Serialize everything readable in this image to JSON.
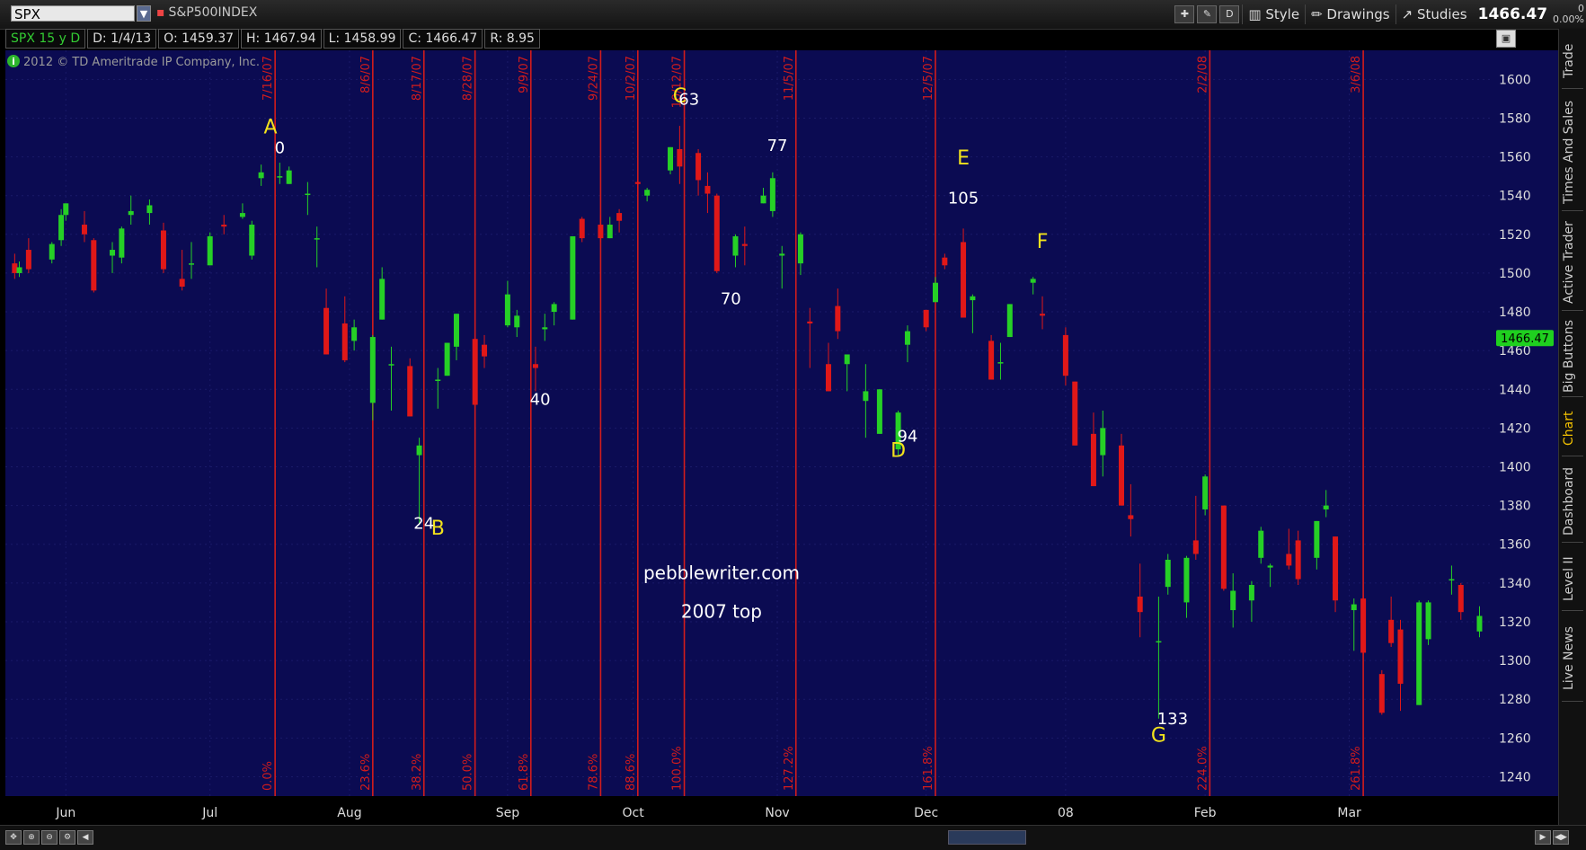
{
  "toolbar": {
    "symbol": "SPX",
    "symbol_name": "S&P500INDEX",
    "style_label": "Style",
    "drawings_label": "Drawings",
    "studies_label": "Studies",
    "d_label": "D",
    "price": "1466.47",
    "change": "0",
    "change_pct": "0.00%"
  },
  "infobar": {
    "symbol_period": "SPX 15 y D",
    "date": "D: 1/4/13",
    "open": "O: 1459.37",
    "high": "H: 1467.94",
    "low": "L: 1458.99",
    "close": "C: 1466.47",
    "range": "R: 8.95"
  },
  "sidebar": {
    "tabs": [
      "Trade",
      "Times And Sales",
      "Active Trader",
      "Big Buttons",
      "Chart",
      "Dashboard",
      "Level II",
      "Live News"
    ],
    "active": "Chart"
  },
  "colors": {
    "background": "#0b0b52",
    "grid": "#1a1a68",
    "up": "#26d026",
    "down": "#e01818",
    "vline": "#d21c1c",
    "letter": "#f2e21c",
    "number": "#ffffff",
    "price_tag": "#1fd01f"
  },
  "chart_data": {
    "type": "candlestick",
    "title": "",
    "copyright": "2012 © TD Ameritrade IP Company, Inc.",
    "ylim": [
      1230,
      1615
    ],
    "y_ticks": [
      1240,
      1260,
      1280,
      1300,
      1320,
      1340,
      1360,
      1380,
      1400,
      1420,
      1440,
      1460,
      1480,
      1500,
      1520,
      1540,
      1560,
      1580,
      1600
    ],
    "x_labels": [
      {
        "label": "Jun",
        "date": "2007-06-01"
      },
      {
        "label": "Jul",
        "date": "2007-07-02"
      },
      {
        "label": "Aug",
        "date": "2007-08-01"
      },
      {
        "label": "Sep",
        "date": "2007-09-04"
      },
      {
        "label": "Oct",
        "date": "2007-10-01"
      },
      {
        "label": "Nov",
        "date": "2007-11-01"
      },
      {
        "label": "Dec",
        "date": "2007-12-03"
      },
      {
        "label": "08",
        "date": "2008-01-02"
      },
      {
        "label": "Feb",
        "date": "2008-02-01"
      },
      {
        "label": "Mar",
        "date": "2008-03-03"
      }
    ],
    "current_price_tag": 1466.47,
    "date_range": [
      "2007-05-21",
      "2008-03-31"
    ],
    "candles": [
      {
        "d": "2007-05-21",
        "o": 1505,
        "h": 1510,
        "l": 1497,
        "c": 1500
      },
      {
        "d": "2007-05-22",
        "o": 1500,
        "h": 1506,
        "l": 1498,
        "c": 1503
      },
      {
        "d": "2007-05-24",
        "o": 1512,
        "h": 1518,
        "l": 1500,
        "c": 1502
      },
      {
        "d": "2007-05-29",
        "o": 1507,
        "h": 1516,
        "l": 1505,
        "c": 1515
      },
      {
        "d": "2007-05-31",
        "o": 1517,
        "h": 1533,
        "l": 1514,
        "c": 1530
      },
      {
        "d": "2007-06-01",
        "o": 1530,
        "h": 1536,
        "l": 1527,
        "c": 1536
      },
      {
        "d": "2007-06-05",
        "o": 1525,
        "h": 1532,
        "l": 1516,
        "c": 1520
      },
      {
        "d": "2007-06-07",
        "o": 1517,
        "h": 1518,
        "l": 1490,
        "c": 1491
      },
      {
        "d": "2007-06-11",
        "o": 1509,
        "h": 1516,
        "l": 1500,
        "c": 1512
      },
      {
        "d": "2007-06-13",
        "o": 1508,
        "h": 1524,
        "l": 1505,
        "c": 1523
      },
      {
        "d": "2007-06-15",
        "o": 1530,
        "h": 1540,
        "l": 1525,
        "c": 1532
      },
      {
        "d": "2007-06-19",
        "o": 1531,
        "h": 1538,
        "l": 1525,
        "c": 1535
      },
      {
        "d": "2007-06-22",
        "o": 1522,
        "h": 1526,
        "l": 1500,
        "c": 1502
      },
      {
        "d": "2007-06-26",
        "o": 1497,
        "h": 1512,
        "l": 1491,
        "c": 1493
      },
      {
        "d": "2007-06-28",
        "o": 1505,
        "h": 1516,
        "l": 1497,
        "c": 1505
      },
      {
        "d": "2007-07-02",
        "o": 1504,
        "h": 1521,
        "l": 1504,
        "c": 1519
      },
      {
        "d": "2007-07-05",
        "o": 1525,
        "h": 1530,
        "l": 1520,
        "c": 1524
      },
      {
        "d": "2007-07-09",
        "o": 1529,
        "h": 1536,
        "l": 1528,
        "c": 1531
      },
      {
        "d": "2007-07-11",
        "o": 1509,
        "h": 1527,
        "l": 1507,
        "c": 1525
      },
      {
        "d": "2007-07-13",
        "o": 1549,
        "h": 1556,
        "l": 1545,
        "c": 1552
      },
      {
        "d": "2007-07-17",
        "o": 1550,
        "h": 1557,
        "l": 1546,
        "c": 1550
      },
      {
        "d": "2007-07-19",
        "o": 1546,
        "h": 1555,
        "l": 1546,
        "c": 1553
      },
      {
        "d": "2007-07-23",
        "o": 1541,
        "h": 1547,
        "l": 1530,
        "c": 1541
      },
      {
        "d": "2007-07-25",
        "o": 1518,
        "h": 1524,
        "l": 1503,
        "c": 1518
      },
      {
        "d": "2007-07-27",
        "o": 1482,
        "h": 1492,
        "l": 1458,
        "c": 1458
      },
      {
        "d": "2007-07-31",
        "o": 1474,
        "h": 1488,
        "l": 1454,
        "c": 1455
      },
      {
        "d": "2007-08-02",
        "o": 1465,
        "h": 1476,
        "l": 1460,
        "c": 1472
      },
      {
        "d": "2007-08-06",
        "o": 1433,
        "h": 1468,
        "l": 1424,
        "c": 1467
      },
      {
        "d": "2007-08-08",
        "o": 1476,
        "h": 1503,
        "l": 1476,
        "c": 1497
      },
      {
        "d": "2007-08-10",
        "o": 1453,
        "h": 1462,
        "l": 1429,
        "c": 1453
      },
      {
        "d": "2007-08-14",
        "o": 1452,
        "h": 1456,
        "l": 1426,
        "c": 1426
      },
      {
        "d": "2007-08-16",
        "o": 1406,
        "h": 1415,
        "l": 1370,
        "c": 1411
      },
      {
        "d": "2007-08-20",
        "o": 1445,
        "h": 1451,
        "l": 1430,
        "c": 1445
      },
      {
        "d": "2007-08-22",
        "o": 1447,
        "h": 1464,
        "l": 1447,
        "c": 1464
      },
      {
        "d": "2007-08-24",
        "o": 1462,
        "h": 1479,
        "l": 1455,
        "c": 1479
      },
      {
        "d": "2007-08-28",
        "o": 1466,
        "h": 1466,
        "l": 1432,
        "c": 1432
      },
      {
        "d": "2007-08-30",
        "o": 1463,
        "h": 1468,
        "l": 1451,
        "c": 1457
      },
      {
        "d": "2007-09-04",
        "o": 1473,
        "h": 1496,
        "l": 1472,
        "c": 1489
      },
      {
        "d": "2007-09-06",
        "o": 1472,
        "h": 1481,
        "l": 1467,
        "c": 1478
      },
      {
        "d": "2007-09-10",
        "o": 1453,
        "h": 1462,
        "l": 1439,
        "c": 1451
      },
      {
        "d": "2007-09-12",
        "o": 1471,
        "h": 1479,
        "l": 1465,
        "c": 1472
      },
      {
        "d": "2007-09-14",
        "o": 1480,
        "h": 1485,
        "l": 1473,
        "c": 1484
      },
      {
        "d": "2007-09-18",
        "o": 1476,
        "h": 1519,
        "l": 1476,
        "c": 1519
      },
      {
        "d": "2007-09-20",
        "o": 1528,
        "h": 1529,
        "l": 1516,
        "c": 1518
      },
      {
        "d": "2007-09-24",
        "o": 1525,
        "h": 1530,
        "l": 1516,
        "c": 1518
      },
      {
        "d": "2007-09-26",
        "o": 1518,
        "h": 1529,
        "l": 1518,
        "c": 1525
      },
      {
        "d": "2007-09-28",
        "o": 1531,
        "h": 1533,
        "l": 1521,
        "c": 1527
      },
      {
        "d": "2007-10-02",
        "o": 1547,
        "h": 1548,
        "l": 1540,
        "c": 1546
      },
      {
        "d": "2007-10-04",
        "o": 1540,
        "h": 1544,
        "l": 1537,
        "c": 1543
      },
      {
        "d": "2007-10-09",
        "o": 1553,
        "h": 1565,
        "l": 1551,
        "c": 1565
      },
      {
        "d": "2007-10-11",
        "o": 1564,
        "h": 1576,
        "l": 1546,
        "c": 1555
      },
      {
        "d": "2007-10-15",
        "o": 1562,
        "h": 1564,
        "l": 1540,
        "c": 1548
      },
      {
        "d": "2007-10-17",
        "o": 1545,
        "h": 1552,
        "l": 1531,
        "c": 1541
      },
      {
        "d": "2007-10-19",
        "o": 1540,
        "h": 1541,
        "l": 1500,
        "c": 1501
      },
      {
        "d": "2007-10-23",
        "o": 1509,
        "h": 1520,
        "l": 1503,
        "c": 1519
      },
      {
        "d": "2007-10-25",
        "o": 1515,
        "h": 1524,
        "l": 1504,
        "c": 1514
      },
      {
        "d": "2007-10-29",
        "o": 1536,
        "h": 1544,
        "l": 1536,
        "c": 1540
      },
      {
        "d": "2007-10-31",
        "o": 1532,
        "h": 1552,
        "l": 1529,
        "c": 1549
      },
      {
        "d": "2007-11-02",
        "o": 1509,
        "h": 1514,
        "l": 1492,
        "c": 1510
      },
      {
        "d": "2007-11-06",
        "o": 1505,
        "h": 1521,
        "l": 1499,
        "c": 1520
      },
      {
        "d": "2007-11-08",
        "o": 1475,
        "h": 1482,
        "l": 1451,
        "c": 1474
      },
      {
        "d": "2007-11-12",
        "o": 1453,
        "h": 1464,
        "l": 1439,
        "c": 1439
      },
      {
        "d": "2007-11-14",
        "o": 1483,
        "h": 1492,
        "l": 1466,
        "c": 1470
      },
      {
        "d": "2007-11-16",
        "o": 1453,
        "h": 1456,
        "l": 1439,
        "c": 1458
      },
      {
        "d": "2007-11-20",
        "o": 1434,
        "h": 1453,
        "l": 1415,
        "c": 1439
      },
      {
        "d": "2007-11-23",
        "o": 1417,
        "h": 1440,
        "l": 1417,
        "c": 1440
      },
      {
        "d": "2007-11-27",
        "o": 1409,
        "h": 1429,
        "l": 1406,
        "c": 1428
      },
      {
        "d": "2007-11-29",
        "o": 1463,
        "h": 1473,
        "l": 1454,
        "c": 1470
      },
      {
        "d": "2007-12-03",
        "o": 1481,
        "h": 1481,
        "l": 1470,
        "c": 1472
      },
      {
        "d": "2007-12-05",
        "o": 1485,
        "h": 1498,
        "l": 1485,
        "c": 1495
      },
      {
        "d": "2007-12-07",
        "o": 1508,
        "h": 1510,
        "l": 1502,
        "c": 1504
      },
      {
        "d": "2007-12-11",
        "o": 1516,
        "h": 1523,
        "l": 1477,
        "c": 1477
      },
      {
        "d": "2007-12-13",
        "o": 1486,
        "h": 1489,
        "l": 1469,
        "c": 1488
      },
      {
        "d": "2007-12-17",
        "o": 1465,
        "h": 1468,
        "l": 1445,
        "c": 1445
      },
      {
        "d": "2007-12-19",
        "o": 1454,
        "h": 1464,
        "l": 1445,
        "c": 1454
      },
      {
        "d": "2007-12-21",
        "o": 1467,
        "h": 1484,
        "l": 1467,
        "c": 1484
      },
      {
        "d": "2007-12-26",
        "o": 1495,
        "h": 1498,
        "l": 1489,
        "c": 1497
      },
      {
        "d": "2007-12-28",
        "o": 1479,
        "h": 1488,
        "l": 1471,
        "c": 1478
      },
      {
        "d": "2008-01-02",
        "o": 1468,
        "h": 1472,
        "l": 1442,
        "c": 1447
      },
      {
        "d": "2008-01-04",
        "o": 1444,
        "h": 1444,
        "l": 1411,
        "c": 1411
      },
      {
        "d": "2008-01-08",
        "o": 1417,
        "h": 1428,
        "l": 1390,
        "c": 1390
      },
      {
        "d": "2008-01-10",
        "o": 1406,
        "h": 1429,
        "l": 1395,
        "c": 1420
      },
      {
        "d": "2008-01-14",
        "o": 1411,
        "h": 1417,
        "l": 1380,
        "c": 1380
      },
      {
        "d": "2008-01-16",
        "o": 1375,
        "h": 1391,
        "l": 1364,
        "c": 1373
      },
      {
        "d": "2008-01-18",
        "o": 1333,
        "h": 1350,
        "l": 1312,
        "c": 1325
      },
      {
        "d": "2008-01-22",
        "o": 1310,
        "h": 1333,
        "l": 1270,
        "c": 1310
      },
      {
        "d": "2008-01-24",
        "o": 1338,
        "h": 1355,
        "l": 1334,
        "c": 1352
      },
      {
        "d": "2008-01-28",
        "o": 1330,
        "h": 1354,
        "l": 1322,
        "c": 1353
      },
      {
        "d": "2008-01-30",
        "o": 1362,
        "h": 1385,
        "l": 1352,
        "c": 1355
      },
      {
        "d": "2008-02-01",
        "o": 1378,
        "h": 1396,
        "l": 1375,
        "c": 1395
      },
      {
        "d": "2008-02-05",
        "o": 1380,
        "h": 1380,
        "l": 1336,
        "c": 1337
      },
      {
        "d": "2008-02-07",
        "o": 1326,
        "h": 1345,
        "l": 1317,
        "c": 1336
      },
      {
        "d": "2008-02-11",
        "o": 1331,
        "h": 1341,
        "l": 1320,
        "c": 1339
      },
      {
        "d": "2008-02-13",
        "o": 1353,
        "h": 1369,
        "l": 1350,
        "c": 1367
      },
      {
        "d": "2008-02-15",
        "o": 1348,
        "h": 1350,
        "l": 1338,
        "c": 1349
      },
      {
        "d": "2008-02-19",
        "o": 1355,
        "h": 1368,
        "l": 1347,
        "c": 1349
      },
      {
        "d": "2008-02-21",
        "o": 1362,
        "h": 1367,
        "l": 1339,
        "c": 1342
      },
      {
        "d": "2008-02-25",
        "o": 1353,
        "h": 1372,
        "l": 1347,
        "c": 1372
      },
      {
        "d": "2008-02-27",
        "o": 1378,
        "h": 1388,
        "l": 1374,
        "c": 1380
      },
      {
        "d": "2008-02-29",
        "o": 1364,
        "h": 1364,
        "l": 1325,
        "c": 1331
      },
      {
        "d": "2008-03-04",
        "o": 1326,
        "h": 1332,
        "l": 1305,
        "c": 1329
      },
      {
        "d": "2008-03-06",
        "o": 1332,
        "h": 1334,
        "l": 1303,
        "c": 1304
      },
      {
        "d": "2008-03-10",
        "o": 1293,
        "h": 1295,
        "l": 1272,
        "c": 1273
      },
      {
        "d": "2008-03-12",
        "o": 1321,
        "h": 1333,
        "l": 1307,
        "c": 1309
      },
      {
        "d": "2008-03-14",
        "o": 1316,
        "h": 1321,
        "l": 1274,
        "c": 1288
      },
      {
        "d": "2008-03-18",
        "o": 1277,
        "h": 1331,
        "l": 1277,
        "c": 1330
      },
      {
        "d": "2008-03-20",
        "o": 1311,
        "h": 1331,
        "l": 1308,
        "c": 1330
      },
      {
        "d": "2008-03-25",
        "o": 1342,
        "h": 1349,
        "l": 1334,
        "c": 1342
      },
      {
        "d": "2008-03-27",
        "o": 1339,
        "h": 1340,
        "l": 1321,
        "c": 1325
      },
      {
        "d": "2008-03-31",
        "o": 1315,
        "h": 1328,
        "l": 1312,
        "c": 1323
      }
    ],
    "vertical_lines": [
      {
        "date": "2007-07-16",
        "top_label": "7/16/07",
        "bottom_label": "0.0%"
      },
      {
        "date": "2007-08-06",
        "top_label": "8/6/07",
        "bottom_label": "23.6%"
      },
      {
        "date": "2007-08-17",
        "top_label": "8/17/07",
        "bottom_label": "38.2%"
      },
      {
        "date": "2007-08-28",
        "top_label": "8/28/07",
        "bottom_label": "50.0%"
      },
      {
        "date": "2007-09-09",
        "top_label": "9/9/07",
        "bottom_label": "61.8%"
      },
      {
        "date": "2007-09-24",
        "top_label": "9/24/07",
        "bottom_label": "78.6%"
      },
      {
        "date": "2007-10-02",
        "top_label": "10/2/07",
        "bottom_label": "88.6%"
      },
      {
        "date": "2007-10-12",
        "top_label": "10/12/07",
        "bottom_label": "100.0%"
      },
      {
        "date": "2007-11-05",
        "top_label": "11/5/07",
        "bottom_label": "127.2%"
      },
      {
        "date": "2007-12-05",
        "top_label": "12/5/07",
        "bottom_label": "161.8%"
      },
      {
        "date": "2008-02-02",
        "top_label": "2/2/08",
        "bottom_label": "224.0%"
      },
      {
        "date": "2008-03-06",
        "top_label": "3/6/08",
        "bottom_label": "261.8%"
      }
    ],
    "letter_annotations": [
      {
        "text": "A",
        "date": "2007-07-15",
        "price": 1572
      },
      {
        "text": "B",
        "date": "2007-08-20",
        "price": 1365
      },
      {
        "text": "C",
        "date": "2007-10-11",
        "price": 1588
      },
      {
        "text": "D",
        "date": "2007-11-27",
        "price": 1405
      },
      {
        "text": "E",
        "date": "2007-12-11",
        "price": 1556
      },
      {
        "text": "F",
        "date": "2007-12-28",
        "price": 1513
      },
      {
        "text": "G",
        "date": "2008-01-22",
        "price": 1258
      }
    ],
    "number_annotations": [
      {
        "text": "0",
        "date": "2007-07-17",
        "price": 1562
      },
      {
        "text": "24",
        "date": "2007-08-17",
        "price": 1368
      },
      {
        "text": "63",
        "date": "2007-10-13",
        "price": 1587
      },
      {
        "text": "70",
        "date": "2007-10-22",
        "price": 1484
      },
      {
        "text": "77",
        "date": "2007-11-01",
        "price": 1563
      },
      {
        "text": "40",
        "date": "2007-09-11",
        "price": 1432
      },
      {
        "text": "94",
        "date": "2007-11-29",
        "price": 1413
      },
      {
        "text": "105",
        "date": "2007-12-11",
        "price": 1536
      },
      {
        "text": "133",
        "date": "2008-01-25",
        "price": 1267
      }
    ],
    "text_annotations": [
      {
        "text": "pebblewriter.com",
        "date": "2007-10-20",
        "price": 1342
      },
      {
        "text": "2007 top",
        "date": "2007-10-20",
        "price": 1322
      }
    ]
  }
}
